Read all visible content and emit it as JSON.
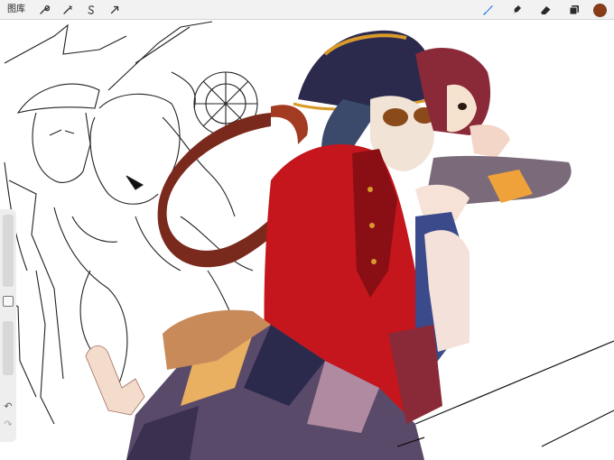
{
  "toolbar": {
    "gallery_label": "图库",
    "left_tools": [
      "wrench-icon",
      "magic-wand-icon",
      "selection-s-icon",
      "transform-arrow-icon"
    ],
    "right_tools": [
      "brush-icon",
      "smudge-icon",
      "eraser-icon",
      "layers-icon"
    ],
    "active_tool": "brush",
    "active_color": "#8a3b18"
  },
  "sidebar": {
    "undo_icon": "undo-icon",
    "redo_icon": "redo-icon"
  },
  "colors": {
    "toolbar_bg": "#f2f2f2",
    "accent_blue": "#1a73e8",
    "coat_red": "#c4161c",
    "hat_navy": "#2b2a4d",
    "gold": "#d89a2a",
    "ribbon": "#7a2a1c"
  }
}
